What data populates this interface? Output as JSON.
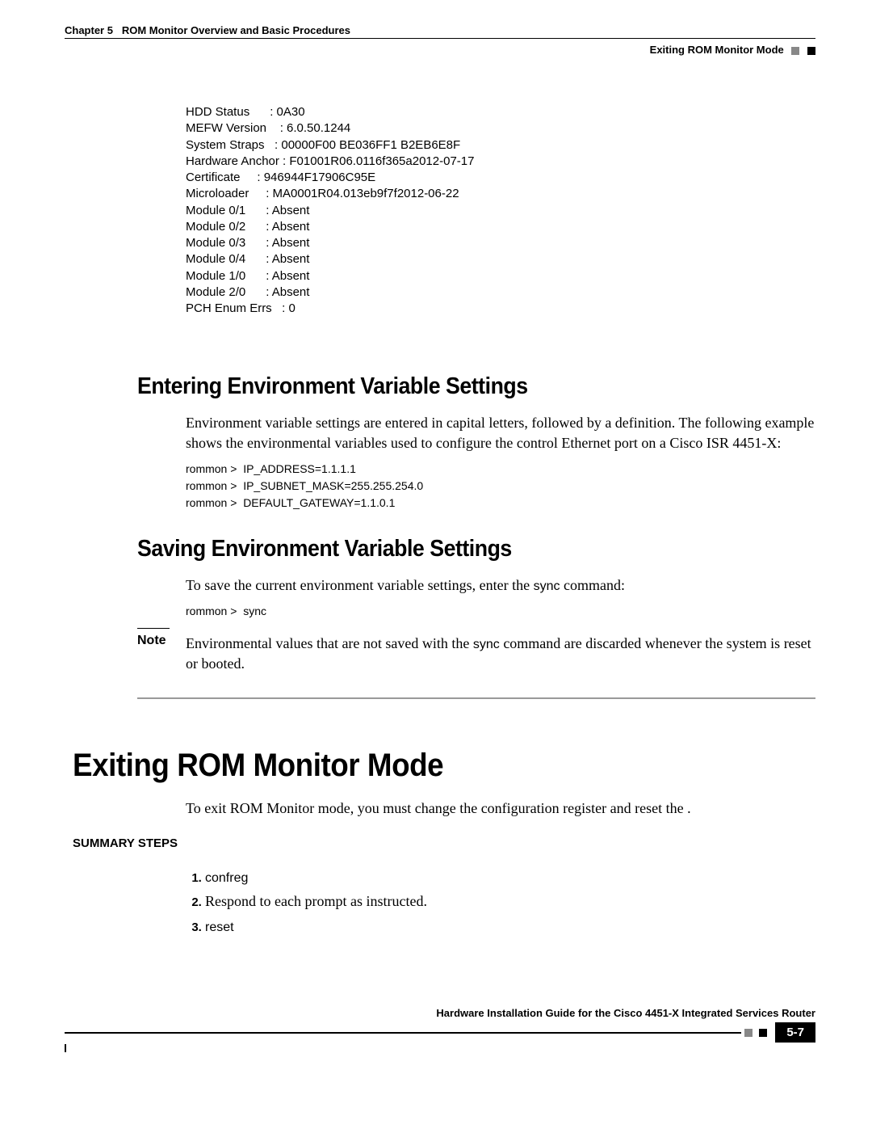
{
  "header": {
    "chapter_label": "Chapter 5",
    "chapter_title": "ROM Monitor Overview and Basic Procedures",
    "breadcrumb": "Exiting ROM Monitor Mode"
  },
  "status_block": "HDD Status      : 0A30\nMEFW Version    : 6.0.50.1244\nSystem Straps   : 00000F00 BE036FF1 B2EB6E8F\nHardware Anchor : F01001R06.0116f365a2012-07-17\nCertificate     : 946944F17906C95E\nMicroloader     : MA0001R04.013eb9f7f2012-06-22\nModule 0/1      : Absent\nModule 0/2      : Absent\nModule 0/3      : Absent\nModule 0/4      : Absent\nModule 1/0      : Absent\nModule 2/0      : Absent\nPCH Enum Errs   : 0",
  "sections": {
    "entering": {
      "heading": "Entering Environment Variable Settings",
      "body": "Environment variable settings are entered in capital letters, followed by a definition. The following example shows the environmental variables used to configure the control Ethernet port on a Cisco ISR 4451-X:",
      "cmd": "rommon >  IP_ADDRESS=1.1.1.1\nrommon >  IP_SUBNET_MASK=255.255.254.0\nrommon >  DEFAULT_GATEWAY=1.1.0.1"
    },
    "saving": {
      "heading": "Saving Environment Variable Settings",
      "body_pre": "To save the current environment variable settings, enter the ",
      "body_cmd": "sync",
      "body_post": " command:",
      "cmd": "rommon >  sync",
      "note_label": "Note",
      "note_pre": "Environmental values that are not saved with the ",
      "note_cmd": "sync",
      "note_post": " command are discarded whenever the system is reset or booted."
    },
    "exiting": {
      "heading": "Exiting ROM Monitor Mode",
      "body": "To exit ROM Monitor mode, you must change the configuration register and reset the .",
      "summary_label": "SUMMARY STEPS",
      "steps": [
        {
          "cmd": "confreg"
        },
        {
          "text": "Respond to each prompt as instructed."
        },
        {
          "cmd": "reset"
        }
      ]
    }
  },
  "footer": {
    "doc_title": "Hardware Installation Guide for the Cisco 4451-X Integrated Services Router",
    "page_num": "5-7"
  }
}
